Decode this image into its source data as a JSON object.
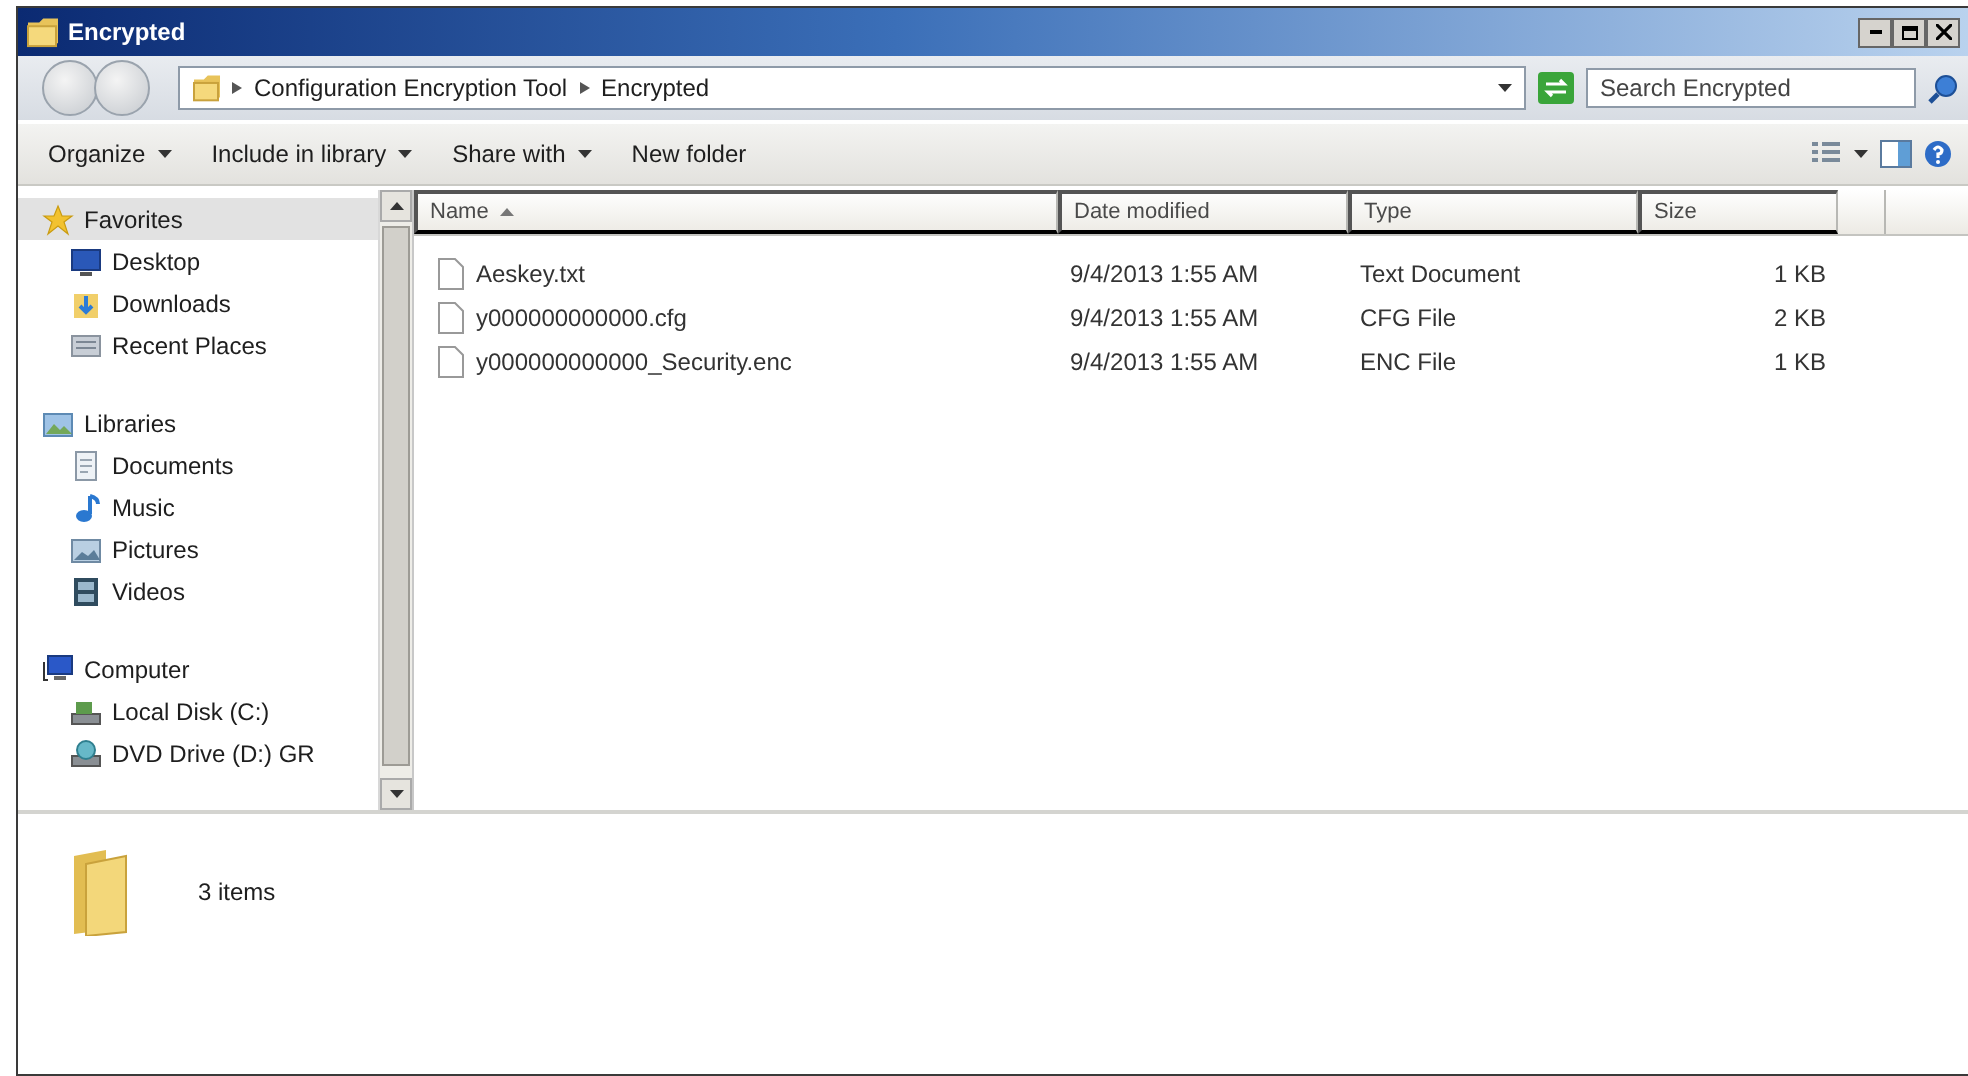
{
  "window": {
    "title": "Encrypted"
  },
  "address_bar": {
    "path": [
      "Configuration Encryption Tool",
      "Encrypted"
    ]
  },
  "search": {
    "placeholder": "Search Encrypted"
  },
  "toolbar": {
    "buttons": [
      {
        "label": "Organize",
        "dropdown": true
      },
      {
        "label": "Include in library",
        "dropdown": true
      },
      {
        "label": "Share with",
        "dropdown": true
      },
      {
        "label": "New folder",
        "dropdown": false
      }
    ]
  },
  "navigation": {
    "items": [
      {
        "label": "Favorites",
        "selected": true,
        "children": [
          {
            "label": "Desktop",
            "selected": false
          },
          {
            "label": "Downloads",
            "selected": false
          },
          {
            "label": "Recent Places",
            "selected": false
          }
        ]
      },
      {
        "label": "Libraries",
        "selected": false,
        "children": [
          {
            "label": "Documents",
            "selected": false
          },
          {
            "label": "Music",
            "selected": false
          },
          {
            "label": "Pictures",
            "selected": false
          },
          {
            "label": "Videos",
            "selected": false
          }
        ]
      },
      {
        "label": "Computer",
        "selected": false,
        "children": [
          {
            "label": "Local Disk (C:)",
            "selected": false
          },
          {
            "label": "DVD Drive (D:) GR",
            "selected": false
          }
        ]
      }
    ]
  },
  "file_list": {
    "columns": [
      {
        "label": "Name",
        "sorted": true
      },
      {
        "label": "Date modified",
        "sorted": false
      },
      {
        "label": "Type",
        "sorted": false
      },
      {
        "label": "Size",
        "sorted": false
      }
    ],
    "rows": [
      {
        "name": "Aeskey.txt",
        "date_modified": "9/4/2013 1:55 AM",
        "type": "Text Document",
        "size": "1 KB"
      },
      {
        "name": "y000000000000.cfg",
        "date_modified": "9/4/2013 1:55 AM",
        "type": "CFG File",
        "size": "2 KB"
      },
      {
        "name": "y000000000000_Security.enc",
        "date_modified": "9/4/2013 1:55 AM",
        "type": "ENC File",
        "size": "1 KB"
      }
    ]
  },
  "status_bar": {
    "item_count": "3 items"
  }
}
